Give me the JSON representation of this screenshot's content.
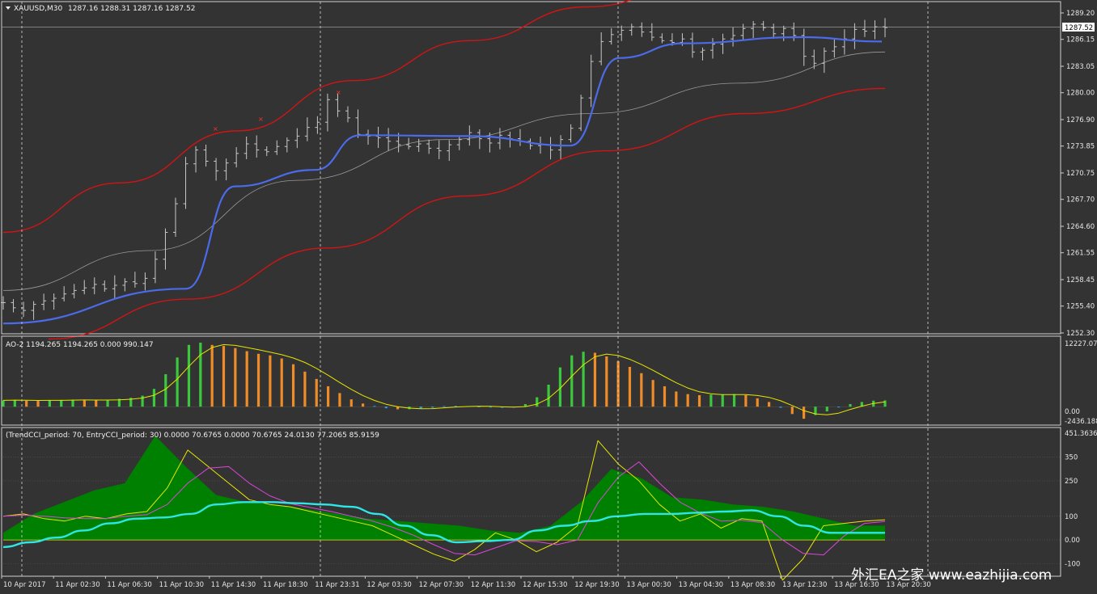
{
  "chart_title": {
    "symbol": "XAUUSD,M30",
    "ohlc": "1287.16 1288.31 1287.16 1287.52"
  },
  "price_axis": {
    "labels": [
      "1289.20",
      "1286.15",
      "1283.05",
      "1280.00",
      "1276.90",
      "1273.85",
      "1270.75",
      "1267.70",
      "1264.60",
      "1261.55",
      "1258.45",
      "1255.40",
      "1252.30"
    ],
    "current_price": "1287.52"
  },
  "ao_panel": {
    "title": "AO-2 1194.265 1194.265 0.000 990.147",
    "axis_labels": [
      "12227.07",
      "0.00",
      "-2436.188"
    ]
  },
  "cci_panel": {
    "title": "(TrendCCI_period: 70, EntryCCI_period: 30)  0.0000 70.6765 0.0000 70.6765 24.0130 77.2065 85.9159",
    "axis_labels": [
      "451.3636",
      "350",
      "250",
      "100",
      "0.00",
      "-100"
    ]
  },
  "time_axis": {
    "labels": [
      "10 Apr 2017",
      "11 Apr 02:30",
      "11 Apr 06:30",
      "11 Apr 10:30",
      "11 Apr 14:30",
      "11 Apr 18:30",
      "11 Apr 23:31",
      "12 Apr 03:30",
      "12 Apr 07:30",
      "12 Apr 11:30",
      "12 Apr 15:30",
      "12 Apr 19:30",
      "13 Apr 00:30",
      "13 Apr 04:30",
      "13 Apr 08:30",
      "13 Apr 12:30",
      "13 Apr 16:30",
      "13 Apr 20:30"
    ]
  },
  "watermark": "外汇EA之家  www.eazhijia.com",
  "colors": {
    "background": "#333333",
    "bars": "#c8c8c8",
    "channel": "#d21414",
    "smooth_ma": "#4b6bea",
    "thin_ma": "#9a9a9a",
    "ao_up": "#3cc83c",
    "ao_down": "#f08c28",
    "ao_small": "#2a9df4",
    "signal": "#e6e600",
    "trend_cci": "#2ee6e6",
    "entry_cci": "#e6e600",
    "magenta": "#dc46dc",
    "fill": "#008000"
  },
  "chart_data": [
    {
      "type": "ohlc",
      "title": "XAUUSD,M30",
      "ylim": [
        1252.3,
        1289.2
      ],
      "close_path": [
        1255.8,
        1255.2,
        1254.9,
        1255.6,
        1256.0,
        1256.3,
        1256.8,
        1257.2,
        1257.5,
        1257.9,
        1257.4,
        1257.8,
        1258.2,
        1258.0,
        1258.6,
        1260.8,
        1263.9,
        1267.2,
        1271.8,
        1273.4,
        1272.1,
        1271.0,
        1271.9,
        1273.0,
        1274.1,
        1273.4,
        1273.2,
        1273.8,
        1274.5,
        1275.0,
        1276.0,
        1276.6,
        1279.2,
        1277.9,
        1277.1,
        1275.2,
        1275.0,
        1274.8,
        1274.4,
        1274.0,
        1273.8,
        1274.1,
        1273.6,
        1273.3,
        1274.0,
        1274.6,
        1275.4,
        1274.7,
        1274.2,
        1275.1,
        1274.7,
        1274.4,
        1273.9,
        1274.0,
        1273.4,
        1274.6,
        1275.9,
        1279.4,
        1283.6,
        1285.9,
        1286.7,
        1287.2,
        1287.6,
        1287.0,
        1286.4,
        1286.0,
        1285.8,
        1286.2,
        1284.7,
        1284.9,
        1285.6,
        1286.2,
        1286.6,
        1287.4,
        1287.9,
        1287.5,
        1286.8,
        1287.4,
        1286.6,
        1284.2,
        1283.4,
        1284.8,
        1285.3,
        1286.2,
        1287.3,
        1287.1,
        1287.6,
        1287.52
      ],
      "series": [
        {
          "name": "Upper Band",
          "values": [
            1263.9,
            1269.6,
            1275.6,
            1281.4,
            1286.0,
            1289.9,
            1292.9
          ]
        },
        {
          "name": "Lower Band",
          "values": [
            1251.6,
            1256.2,
            1262.1,
            1268.1,
            1273.3,
            1277.6,
            1280.5
          ]
        },
        {
          "name": "Smooth MA",
          "values": [
            1253.4,
            1257.4,
            1269.2,
            1271.1,
            1275.1,
            1275.0,
            1273.9,
            1284.0,
            1285.7,
            1286.4,
            1285.9
          ]
        },
        {
          "name": "Trend MA",
          "values": [
            1257.2,
            1261.8,
            1269.9,
            1274.6,
            1277.6,
            1281.1,
            1284.7
          ]
        }
      ]
    },
    {
      "type": "bar",
      "title": "AO-2",
      "ylim": [
        -2436.188,
        12227.07
      ],
      "values": [
        1200,
        1300,
        1150,
        1100,
        1250,
        1300,
        1350,
        1250,
        1200,
        1300,
        1500,
        1700,
        2100,
        3400,
        6200,
        9400,
        11800,
        12227,
        11800,
        11600,
        11200,
        10600,
        10100,
        9800,
        9200,
        8100,
        6700,
        5300,
        3900,
        2600,
        1400,
        600,
        150,
        -300,
        -500,
        -480,
        -300,
        -200,
        100,
        150,
        100,
        50,
        -50,
        -200,
        -150,
        500,
        1800,
        4200,
        7500,
        9800,
        10500,
        10300,
        9600,
        8700,
        7600,
        6400,
        5100,
        3900,
        2900,
        2400,
        2200,
        2300,
        2300,
        2400,
        2200,
        1600,
        900,
        -200,
        -1400,
        -2300,
        -1600,
        -900,
        -100,
        500,
        900,
        1150,
        1194
      ],
      "series": [
        {
          "name": "AO",
          "values": [
            1194.265
          ]
        },
        {
          "name": "Signal",
          "values": [
            990.147
          ]
        }
      ]
    },
    {
      "type": "line",
      "title": "TrendCCI / EntryCCI",
      "ylim": [
        -150,
        451.3636
      ],
      "series": [
        {
          "name": "TrendCCI",
          "values": [
            -30,
            -10,
            10,
            40,
            70,
            90,
            95,
            110,
            150,
            160,
            160,
            155,
            150,
            140,
            110,
            60,
            20,
            -10,
            -5,
            0,
            40,
            60,
            80,
            100,
            110,
            110,
            115,
            120,
            125,
            100,
            60,
            30,
            30,
            30
          ]
        },
        {
          "name": "EntryCCI",
          "values": [
            100,
            110,
            90,
            80,
            100,
            90,
            110,
            120,
            220,
            380,
            310,
            240,
            170,
            150,
            140,
            120,
            100,
            80,
            60,
            20,
            -20,
            -60,
            -90,
            -40,
            30,
            0,
            -50,
            -10,
            60,
            420,
            320,
            250,
            150,
            80,
            110,
            50,
            90,
            80,
            -170,
            -80,
            60,
            70,
            80,
            85
          ]
        },
        {
          "name": "Trend Fill",
          "values": [
            30,
            110,
            160,
            210,
            240,
            440,
            310,
            190,
            160,
            150,
            130,
            110,
            90,
            80,
            70,
            60,
            40,
            30,
            60,
            160,
            300,
            260,
            180,
            170,
            150,
            140,
            120,
            90,
            60,
            60
          ]
        }
      ]
    }
  ]
}
